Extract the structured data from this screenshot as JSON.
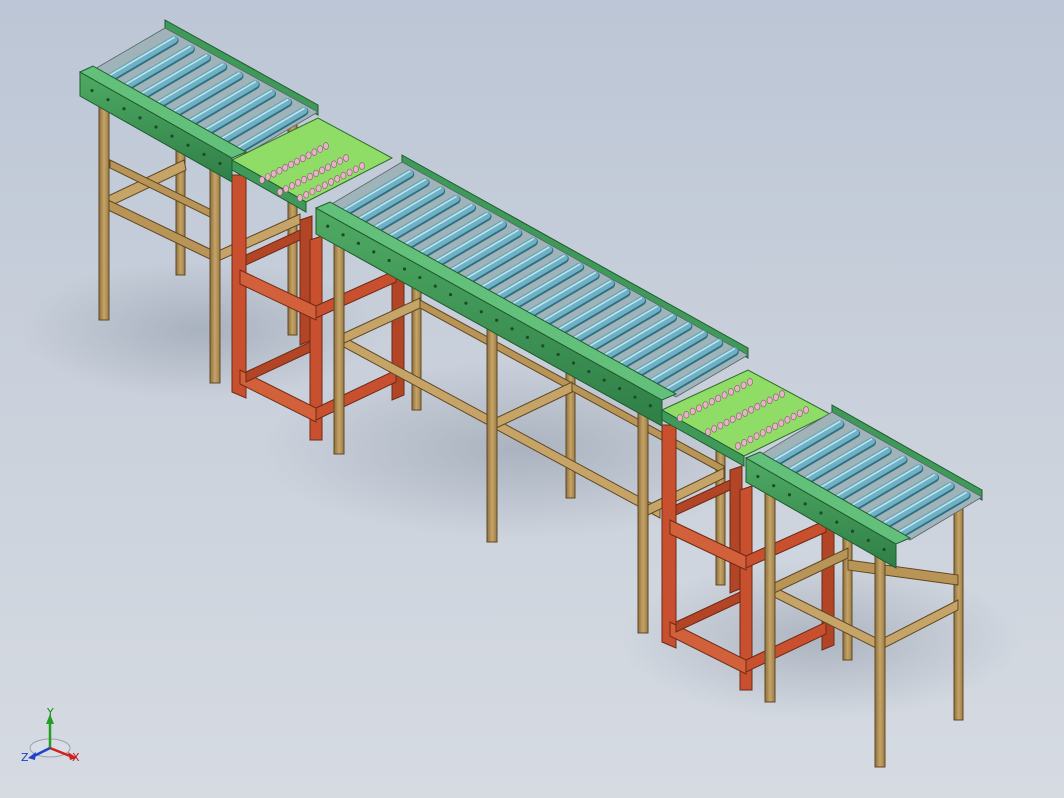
{
  "triad": {
    "x_label": "X",
    "y_label": "Y",
    "z_label": "Z"
  },
  "colors": {
    "background_top": "#bcc6d6",
    "background_bottom": "#d6dbe2",
    "conveyor_frame_green": "#3f9a5a",
    "transfer_plate_green": "#7fe05a",
    "roller_blue": "#6fb0c4",
    "wood_leg": "#b08f55",
    "red_frame": "#c8502e",
    "bead_pink": "#e6b3c8",
    "axis_x": "#d02020",
    "axis_y": "#20a020",
    "axis_z": "#2040d0"
  },
  "model": {
    "conveyor_sections": [
      "left-roller-conveyor",
      "middle-roller-conveyor",
      "right-roller-conveyor"
    ],
    "transfer_units": [
      "left-transfer-unit",
      "right-transfer-unit"
    ],
    "roller_counts": [
      9,
      22,
      9
    ]
  }
}
